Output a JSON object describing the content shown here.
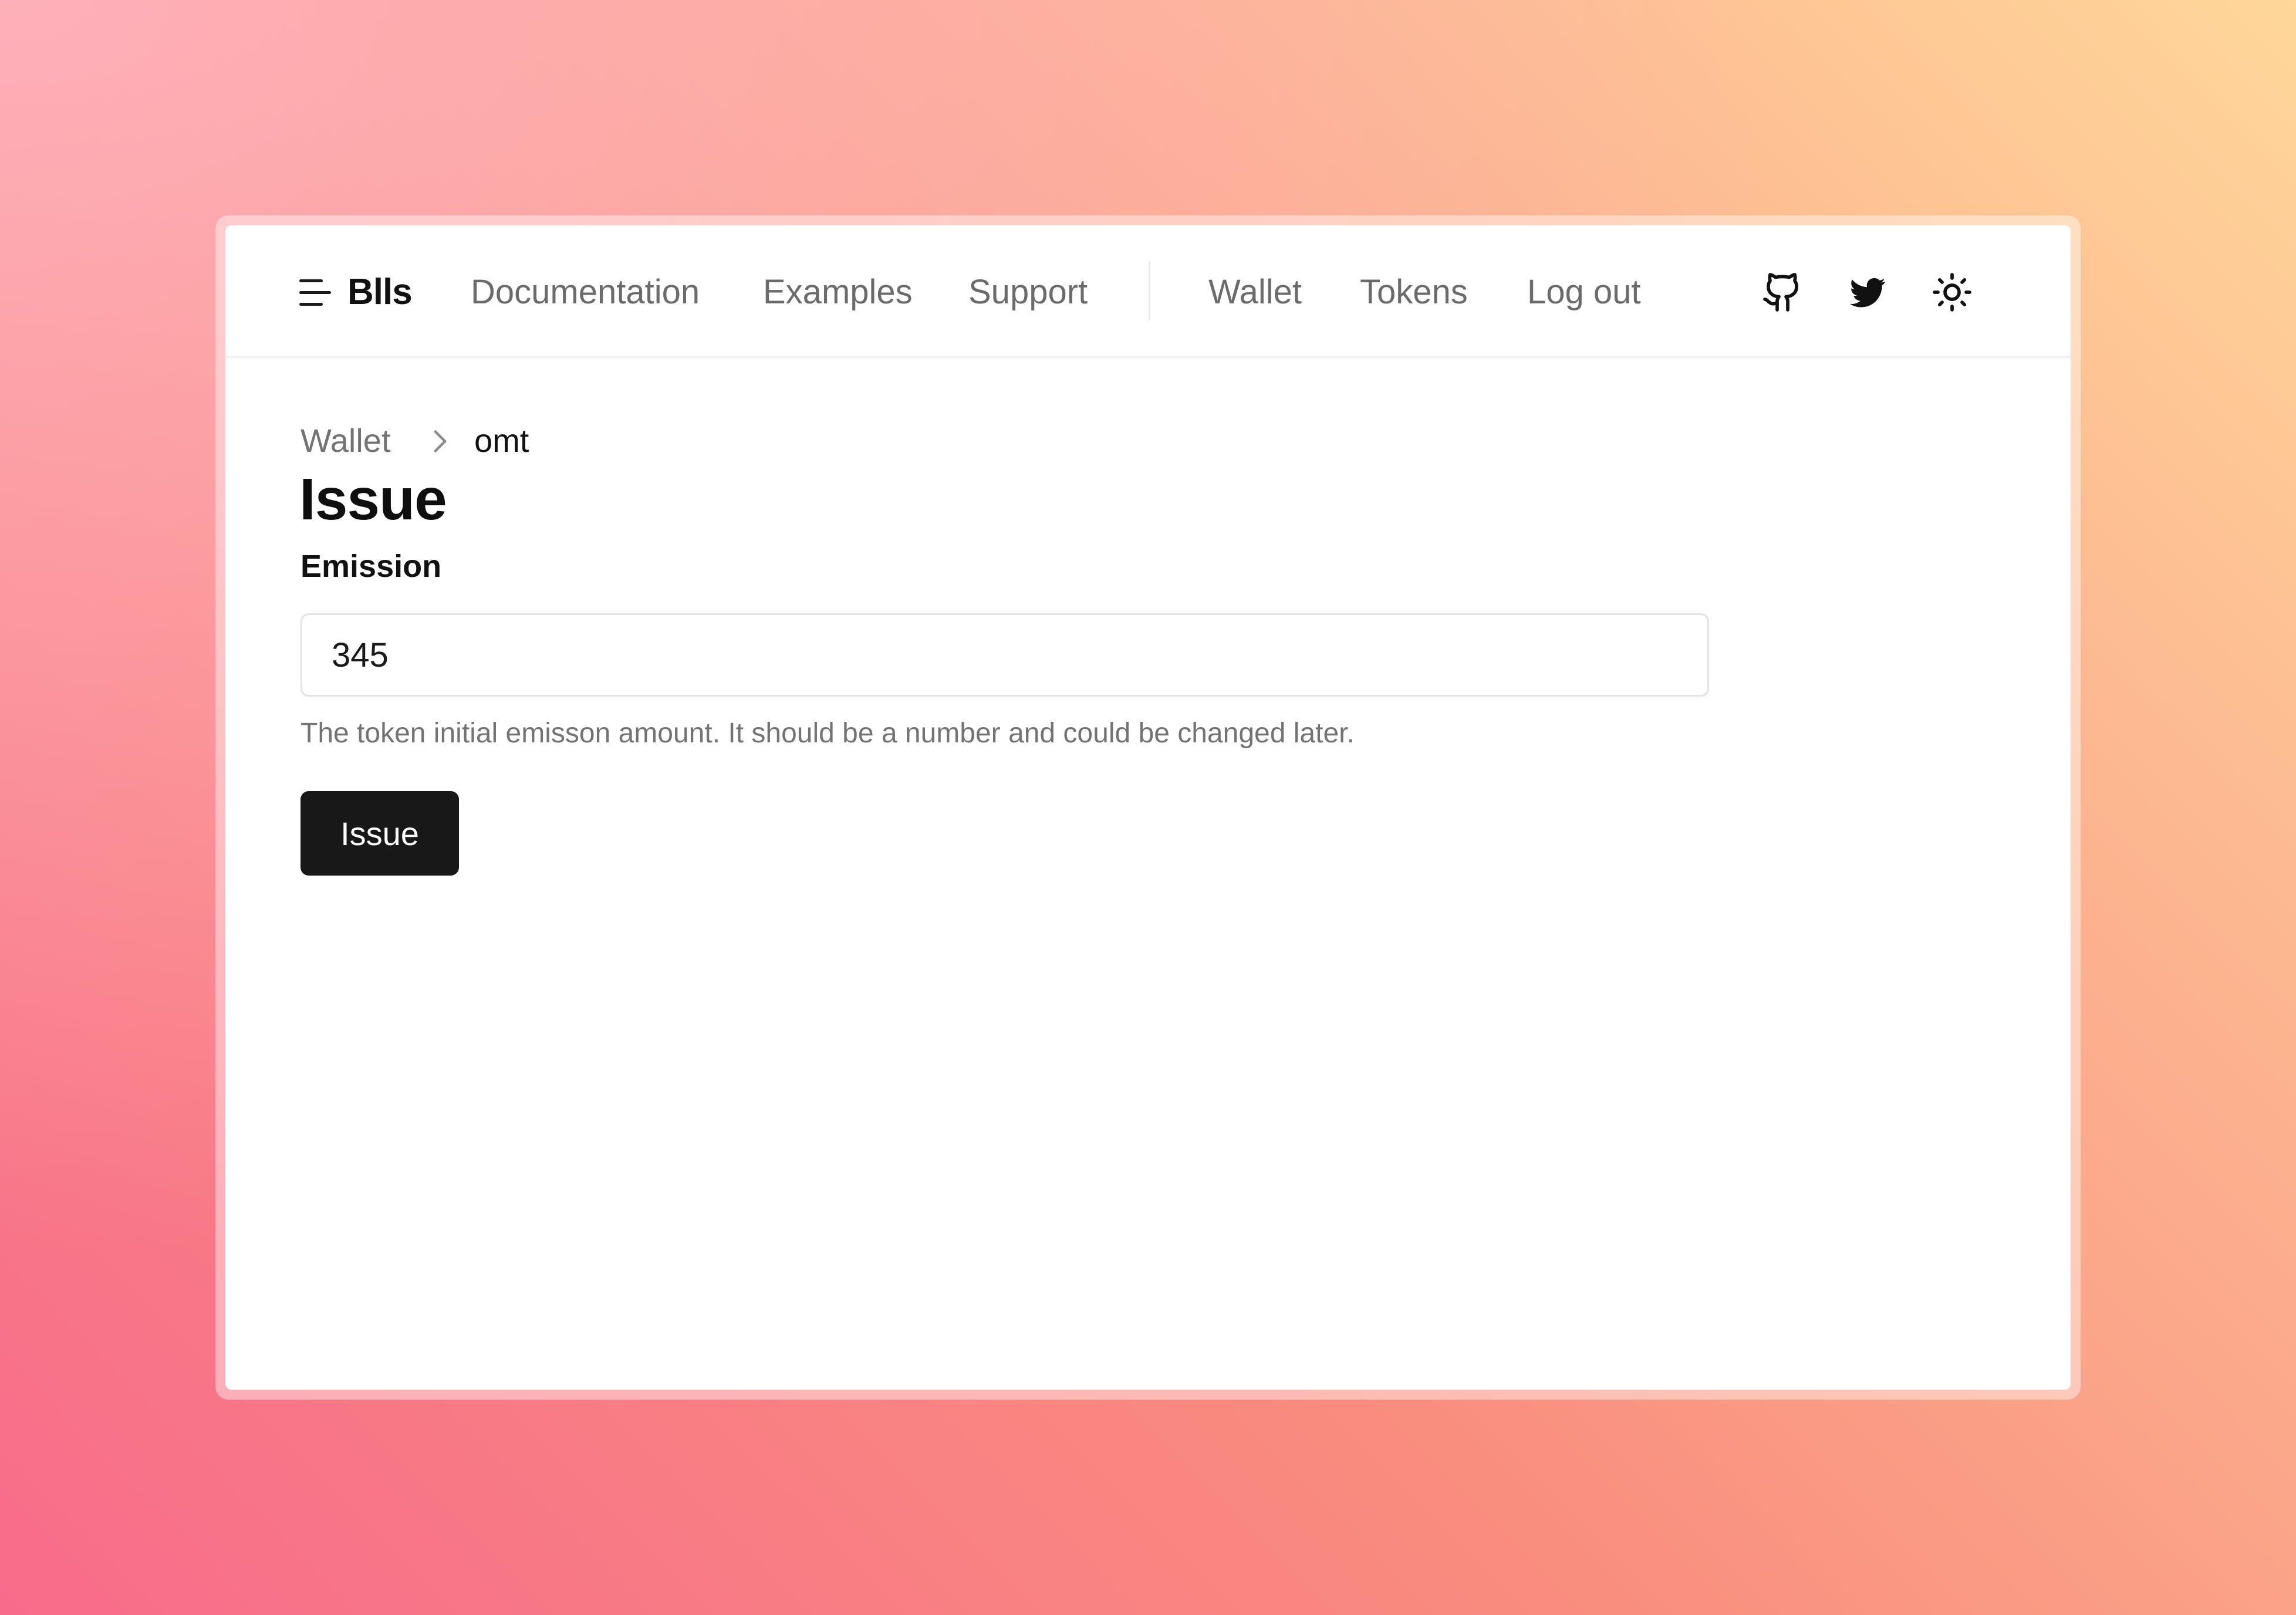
{
  "nav": {
    "brand": "Blls",
    "links": [
      "Documentation",
      "Examples",
      "Support"
    ],
    "account_links": [
      "Wallet",
      "Tokens",
      "Log out"
    ],
    "icons": [
      "github-icon",
      "twitter-icon",
      "sun-icon"
    ]
  },
  "breadcrumb": {
    "parent": "Wallet",
    "current": "omt"
  },
  "page": {
    "title": "Issue"
  },
  "form": {
    "label": "Emission",
    "value": "345",
    "help": "The token initial emisson amount. It should be a number and could be changed later.",
    "submit_label": "Issue"
  },
  "colors": {
    "primary_button": "#181818",
    "muted_text": "#737373",
    "text": "#111111"
  }
}
